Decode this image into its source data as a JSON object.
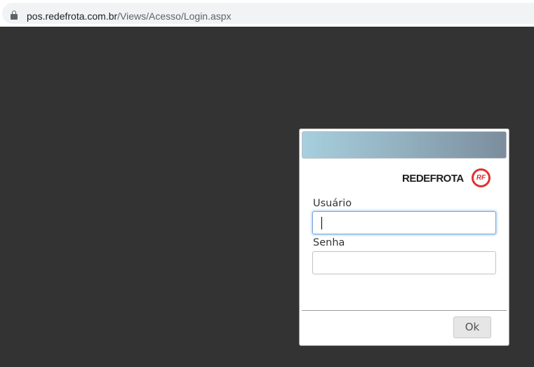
{
  "browser": {
    "url_host": "pos.redefrota.com.br",
    "url_path": "/Views/Acesso/Login.aspx",
    "lock_icon": "lock-icon"
  },
  "login": {
    "logo_text": "REDEFROTA",
    "logo_badge": "RF",
    "username_label": "Usuário",
    "username_value": "",
    "password_label": "Senha",
    "password_value": "",
    "ok_label": "Ok"
  },
  "colors": {
    "page_background": "#333333",
    "header_gradient_start": "#a7cfdd",
    "header_gradient_end": "#7b8d9d",
    "logo_accent": "#e03030"
  }
}
